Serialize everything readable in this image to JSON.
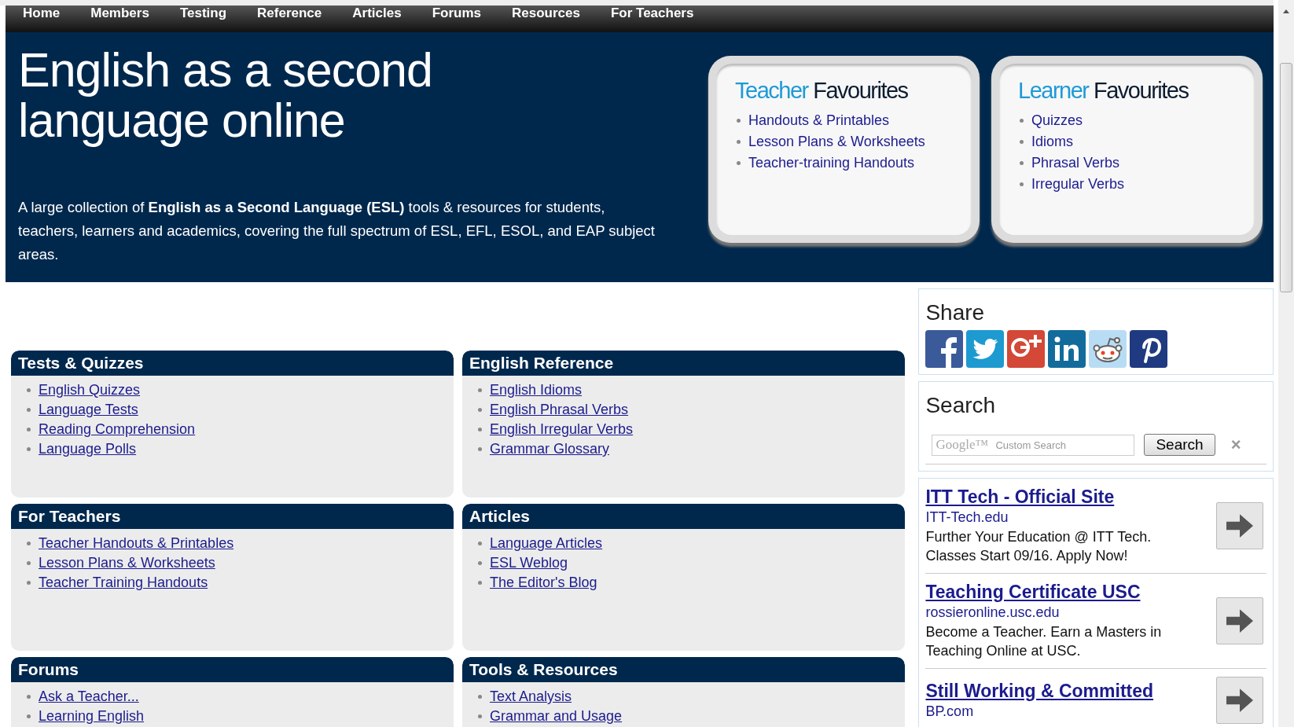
{
  "nav": [
    "Home",
    "Members",
    "Testing",
    "Reference",
    "Articles",
    "Forums",
    "Resources",
    "For Teachers"
  ],
  "hero": {
    "title_lines": [
      "English as a second",
      "language online"
    ],
    "intro": "A large collection of **English as a Second Language (ESL)** tools & resources for students, teachers, learners and academics, covering the full spectrum of ESL, EFL, ESOL, and EAP subject areas."
  },
  "favourites": [
    {
      "accent": "Teacher",
      "title": "Favourites",
      "items": [
        "Handouts & Printables",
        "Lesson Plans & Worksheets",
        "Teacher-training Handouts"
      ]
    },
    {
      "accent": "Learner",
      "title": "Favourites",
      "items": [
        "Quizzes",
        "Idioms",
        "Phrasal Verbs",
        "Irregular Verbs"
      ]
    }
  ],
  "sections": [
    {
      "title": "Tests & Quizzes",
      "links": [
        "English Quizzes",
        "Language Tests",
        "Reading Comprehension",
        "Language Polls"
      ]
    },
    {
      "title": "English Reference",
      "links": [
        "English Idioms",
        "English Phrasal Verbs",
        "English Irregular Verbs",
        "Grammar Glossary"
      ]
    },
    {
      "title": "For Teachers",
      "links": [
        "Teacher Handouts & Printables",
        "Lesson Plans & Worksheets",
        "Teacher Training Handouts"
      ]
    },
    {
      "title": "Articles",
      "links": [
        "Language Articles",
        "ESL Weblog",
        "The Editor's Blog"
      ]
    },
    {
      "title": "Forums",
      "links": [
        "Ask a Teacher...",
        "Learning English"
      ]
    },
    {
      "title": "Tools & Resources",
      "links": [
        "Text Analysis",
        "Grammar and Usage"
      ]
    }
  ],
  "share": {
    "title": "Share",
    "buttons": [
      {
        "kind": "facebook"
      },
      {
        "kind": "twitter"
      },
      {
        "kind": "googleplus"
      },
      {
        "kind": "linkedin"
      },
      {
        "kind": "reddit"
      },
      {
        "kind": "pinterest"
      }
    ]
  },
  "search": {
    "title": "Search",
    "brand": "Google™",
    "placeholder": "Custom Search",
    "button": "Search",
    "clear": "×"
  },
  "ads": [
    {
      "title": "ITT Tech - Official Site",
      "domain": "ITT-Tech.edu",
      "text": "Further Your Education @ ITT Tech. Classes Start 09/16. Apply Now!"
    },
    {
      "title": "Teaching Certificate USC",
      "domain": "rossieronline.usc.edu",
      "text": "Become a Teacher. Earn a Masters in Teaching Online at USC."
    },
    {
      "title": "Still Working & Committed",
      "domain": "BP.com"
    }
  ]
}
